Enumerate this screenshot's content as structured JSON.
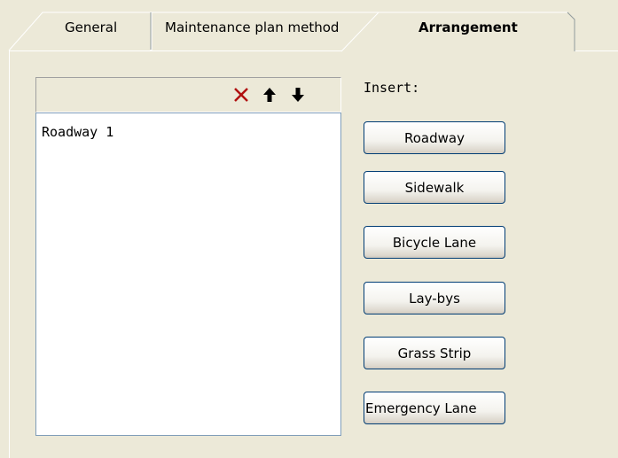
{
  "tabs": [
    {
      "label": "General",
      "active": false
    },
    {
      "label": "Maintenance plan method",
      "active": false
    },
    {
      "label": "Arrangement",
      "active": true
    }
  ],
  "list": {
    "toolbar": {
      "delete_icon": "x-icon",
      "move_up_icon": "arrow-up-icon",
      "move_down_icon": "arrow-down-icon",
      "delete_color": "#b01010"
    },
    "items": [
      "Roadway 1"
    ]
  },
  "insert": {
    "label": "Insert:",
    "buttons": [
      "Roadway",
      "Sidewalk",
      "Bicycle Lane",
      "Lay-bys",
      "Grass Strip",
      "Emergency Lane"
    ]
  },
  "colors": {
    "background": "#ece9d8",
    "button_border": "#003c74",
    "list_border": "#7f9db9"
  }
}
